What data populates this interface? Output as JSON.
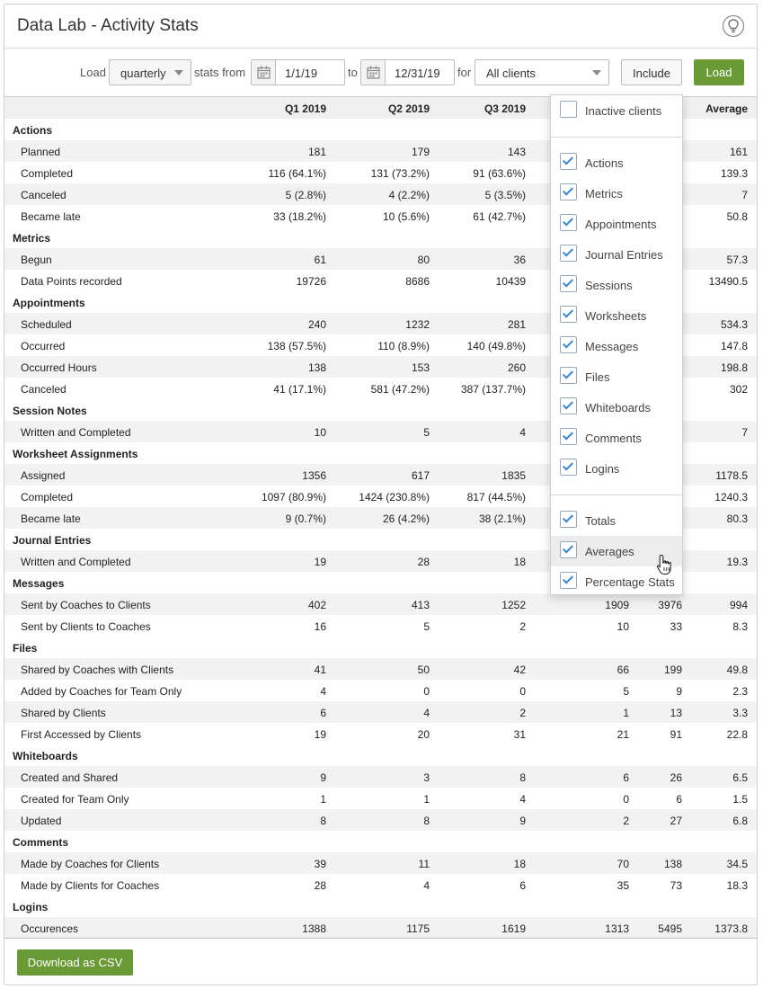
{
  "title": "Data Lab - Activity Stats",
  "toolbar": {
    "load_label": "Load",
    "period": "quarterly",
    "stats_from_label": "stats from",
    "from_date": "1/1/19",
    "to_label": "to",
    "to_date": "12/31/19",
    "for_label": "for",
    "clients": "All clients",
    "include_label": "Include",
    "load_button": "Load"
  },
  "table": {
    "headers": [
      "",
      "Q1 2019",
      "Q2 2019",
      "Q3 2019",
      "",
      "",
      "Average"
    ],
    "rows": [
      {
        "section": true,
        "label": "Actions"
      },
      {
        "label": "Planned",
        "c": [
          "181",
          "179",
          "143",
          "",
          "",
          "161"
        ]
      },
      {
        "label": "Completed",
        "c": [
          "116 (64.1%)",
          "131 (73.2%)",
          "91 (63.6%)",
          "",
          "",
          "139.3"
        ]
      },
      {
        "label": "Canceled",
        "c": [
          "5 (2.8%)",
          "4 (2.2%)",
          "5 (3.5%)",
          "",
          "",
          "7"
        ]
      },
      {
        "label": "Became late",
        "c": [
          "33 (18.2%)",
          "10 (5.6%)",
          "61 (42.7%)",
          "",
          "",
          "50.8"
        ]
      },
      {
        "section": true,
        "label": "Metrics"
      },
      {
        "label": "Begun",
        "c": [
          "61",
          "80",
          "36",
          "",
          "",
          "57.3"
        ]
      },
      {
        "label": "Data Points recorded",
        "c": [
          "19726",
          "8686",
          "10439",
          "",
          "",
          "13490.5"
        ]
      },
      {
        "section": true,
        "label": "Appointments"
      },
      {
        "label": "Scheduled",
        "c": [
          "240",
          "1232",
          "281",
          "",
          "",
          "534.3"
        ]
      },
      {
        "label": "Occurred",
        "c": [
          "138 (57.5%)",
          "110 (8.9%)",
          "140 (49.8%)",
          "",
          "",
          "147.8"
        ]
      },
      {
        "label": "Occurred Hours",
        "c": [
          "138",
          "153",
          "260",
          "",
          "",
          "198.8"
        ]
      },
      {
        "label": "Canceled",
        "c": [
          "41 (17.1%)",
          "581 (47.2%)",
          "387 (137.7%)",
          "",
          "",
          "302"
        ]
      },
      {
        "section": true,
        "label": "Session Notes"
      },
      {
        "label": "Written and Completed",
        "c": [
          "10",
          "5",
          "4",
          "",
          "",
          "7"
        ]
      },
      {
        "section": true,
        "label": "Worksheet Assignments"
      },
      {
        "label": "Assigned",
        "c": [
          "1356",
          "617",
          "1835",
          "",
          "",
          "1178.5"
        ]
      },
      {
        "label": "Completed",
        "c": [
          "1097 (80.9%)",
          "1424 (230.8%)",
          "817 (44.5%)",
          "",
          "",
          "1240.3"
        ]
      },
      {
        "label": "Became late",
        "c": [
          "9 (0.7%)",
          "26 (4.2%)",
          "38 (2.1%)",
          "",
          "",
          "80.3"
        ]
      },
      {
        "section": true,
        "label": "Journal Entries"
      },
      {
        "label": "Written and Completed",
        "c": [
          "19",
          "28",
          "18",
          "",
          "",
          "19.3"
        ]
      },
      {
        "section": true,
        "label": "Messages"
      },
      {
        "label": "Sent by Coaches to Clients",
        "c": [
          "402",
          "413",
          "1252",
          "1909",
          "3976",
          "994"
        ]
      },
      {
        "label": "Sent by Clients to Coaches",
        "c": [
          "16",
          "5",
          "2",
          "10",
          "33",
          "8.3"
        ]
      },
      {
        "section": true,
        "label": "Files"
      },
      {
        "label": "Shared by Coaches with Clients",
        "c": [
          "41",
          "50",
          "42",
          "66",
          "199",
          "49.8"
        ]
      },
      {
        "label": "Added by Coaches for Team Only",
        "c": [
          "4",
          "0",
          "0",
          "5",
          "9",
          "2.3"
        ]
      },
      {
        "label": "Shared by Clients",
        "c": [
          "6",
          "4",
          "2",
          "1",
          "13",
          "3.3"
        ]
      },
      {
        "label": "First Accessed by Clients",
        "c": [
          "19",
          "20",
          "31",
          "21",
          "91",
          "22.8"
        ]
      },
      {
        "section": true,
        "label": "Whiteboards"
      },
      {
        "label": "Created and Shared",
        "c": [
          "9",
          "3",
          "8",
          "6",
          "26",
          "6.5"
        ]
      },
      {
        "label": "Created for Team Only",
        "c": [
          "1",
          "1",
          "4",
          "0",
          "6",
          "1.5"
        ]
      },
      {
        "label": "Updated",
        "c": [
          "8",
          "8",
          "9",
          "2",
          "27",
          "6.8"
        ]
      },
      {
        "section": true,
        "label": "Comments"
      },
      {
        "label": "Made by Coaches for Clients",
        "c": [
          "39",
          "11",
          "18",
          "70",
          "138",
          "34.5"
        ]
      },
      {
        "label": "Made by Clients for Coaches",
        "c": [
          "28",
          "4",
          "6",
          "35",
          "73",
          "18.3"
        ]
      },
      {
        "section": true,
        "label": "Logins"
      },
      {
        "label": "Occurences",
        "c": [
          "1388",
          "1175",
          "1619",
          "1313",
          "5495",
          "1373.8"
        ]
      }
    ]
  },
  "include_menu": {
    "groups": [
      [
        {
          "label": "Inactive clients",
          "checked": false
        }
      ],
      [
        {
          "label": "Actions",
          "checked": true
        },
        {
          "label": "Metrics",
          "checked": true
        },
        {
          "label": "Appointments",
          "checked": true
        },
        {
          "label": "Journal Entries",
          "checked": true
        },
        {
          "label": "Sessions",
          "checked": true
        },
        {
          "label": "Worksheets",
          "checked": true
        },
        {
          "label": "Messages",
          "checked": true
        },
        {
          "label": "Files",
          "checked": true
        },
        {
          "label": "Whiteboards",
          "checked": true
        },
        {
          "label": "Comments",
          "checked": true
        },
        {
          "label": "Logins",
          "checked": true
        }
      ],
      [
        {
          "label": "Totals",
          "checked": true
        },
        {
          "label": "Averages",
          "checked": true,
          "hovered": true
        },
        {
          "label": "Percentage Stats",
          "checked": true
        }
      ]
    ]
  },
  "footer": {
    "download_label": "Download as CSV"
  },
  "colors": {
    "accent_green": "#6a9a35",
    "checkbox_blue": "#3a86c8",
    "row_alt": "#f2f2f2"
  },
  "icons": {
    "help": "lightbulb-icon",
    "calendar": "calendar-icon",
    "cursor": "hand-pointer-icon"
  }
}
